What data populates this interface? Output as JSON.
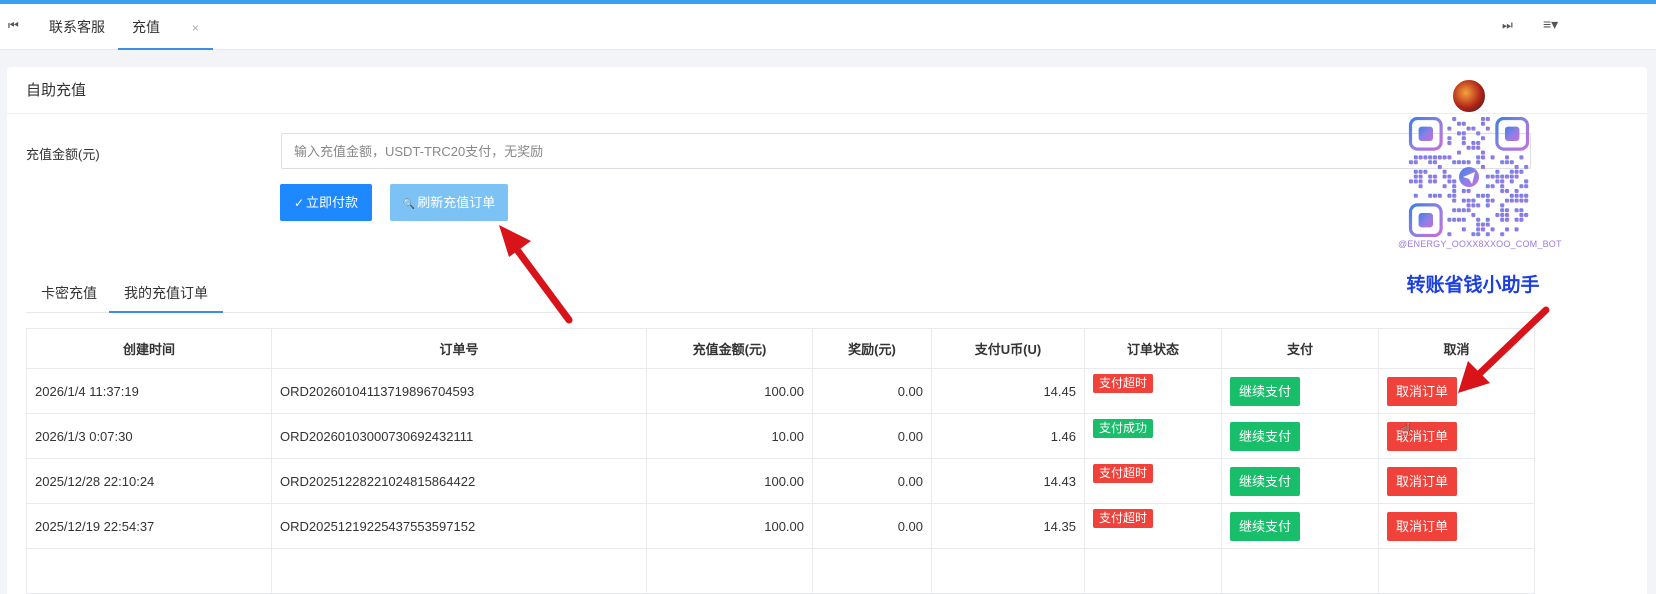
{
  "tabbar": {
    "first_icon": "⏮",
    "last_icon": "⏭",
    "menu_icon": "≡▾",
    "tabs": [
      {
        "label": "联系客服"
      },
      {
        "label": "充值",
        "close": "×"
      }
    ]
  },
  "card": {
    "title": "自助充值",
    "amount_label": "充值金额(元)",
    "amount_placeholder": "输入充值金额，USDT-TRC20支付，无奖励",
    "pay_button": "立即付款",
    "pay_icon": "✓",
    "refresh_button": "刷新充值订单",
    "refresh_icon": "🔍"
  },
  "subtabs": [
    {
      "label": "卡密充值"
    },
    {
      "label": "我的充值订单"
    }
  ],
  "table": {
    "headers": [
      "创建时间",
      "订单号",
      "充值金额(元)",
      "奖励(元)",
      "支付U币(U)",
      "订单状态",
      "支付",
      "取消"
    ],
    "rows": [
      {
        "time": "2026/1/4 11:37:19",
        "order": "ORD20260104113719896704593",
        "amount": "100.00",
        "reward": "0.00",
        "usdt": "14.45",
        "status": "支付超时",
        "status_color": "#f0413a",
        "pay": "继续支付",
        "cancel": "取消订单"
      },
      {
        "time": "2026/1/3 0:07:30",
        "order": "ORD20260103000730692432111",
        "amount": "10.00",
        "reward": "0.00",
        "usdt": "1.46",
        "status": "支付成功",
        "status_color": "#19be6b",
        "pay": "继续支付",
        "cancel": "取消订单"
      },
      {
        "time": "2025/12/28 22:10:24",
        "order": "ORD20251228221024815864422",
        "amount": "100.00",
        "reward": "0.00",
        "usdt": "14.43",
        "status": "支付超时",
        "status_color": "#f0413a",
        "pay": "继续支付",
        "cancel": "取消订单"
      },
      {
        "time": "2025/12/19 22:54:37",
        "order": "ORD20251219225437553597152",
        "amount": "100.00",
        "reward": "0.00",
        "usdt": "14.35",
        "status": "支付超时",
        "status_color": "#f0413a",
        "pay": "继续支付",
        "cancel": "取消订单"
      },
      {
        "time": "",
        "order": "",
        "amount": "",
        "reward": "",
        "usdt": "",
        "status": "",
        "status_color": "#f0413a",
        "pay": "",
        "cancel": ""
      }
    ]
  },
  "promo": {
    "handle": "@ENERGY_OOXX8XXOO_COM_BOT",
    "caption": "转账省钱小助手",
    "qr_colors": [
      "#3d7fe3",
      "#8c7fe6",
      "#c46fd8"
    ]
  },
  "colors": {
    "accent": "#3a9ff0",
    "primary_button": "#1e88ff",
    "secondary_button": "#7cc2f5",
    "success": "#19be6b",
    "danger": "#f0413a",
    "amount_text": "#1c8a1c",
    "arrow": "#d8141a"
  }
}
